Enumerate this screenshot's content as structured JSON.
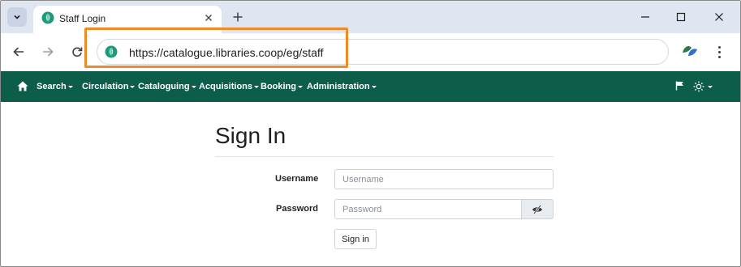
{
  "browser": {
    "tab_title": "Staff Login",
    "address": "https://catalogue.libraries.coop/eg/staff",
    "icons": {
      "tab_list": "chevron-down-icon",
      "favicon": "evergreen-leaf-icon",
      "close_tab": "close-icon",
      "new_tab": "plus-icon",
      "minimize": "minimize-icon",
      "maximize": "maximize-icon",
      "close_window": "close-icon",
      "back": "back-arrow-icon",
      "forward": "forward-arrow-icon",
      "reload": "reload-icon",
      "extension": "extension-icon",
      "menu": "kebab-menu-icon"
    },
    "highlight_color": "#f08a24"
  },
  "navbar": {
    "background": "#0c5d4a",
    "items": [
      {
        "label": "Search"
      },
      {
        "label": "Circulation"
      },
      {
        "label": "Cataloguing"
      },
      {
        "label": "Acquisitions"
      },
      {
        "label": "Booking"
      },
      {
        "label": "Administration"
      }
    ],
    "icons": {
      "home": "home-icon",
      "flag": "flag-icon",
      "theme": "sun-icon"
    }
  },
  "login": {
    "title": "Sign In",
    "username_label": "Username",
    "username_placeholder": "Username",
    "username_value": "",
    "password_label": "Password",
    "password_placeholder": "Password",
    "password_value": "",
    "toggle_icon": "eye-slash-icon",
    "submit_label": "Sign in"
  }
}
